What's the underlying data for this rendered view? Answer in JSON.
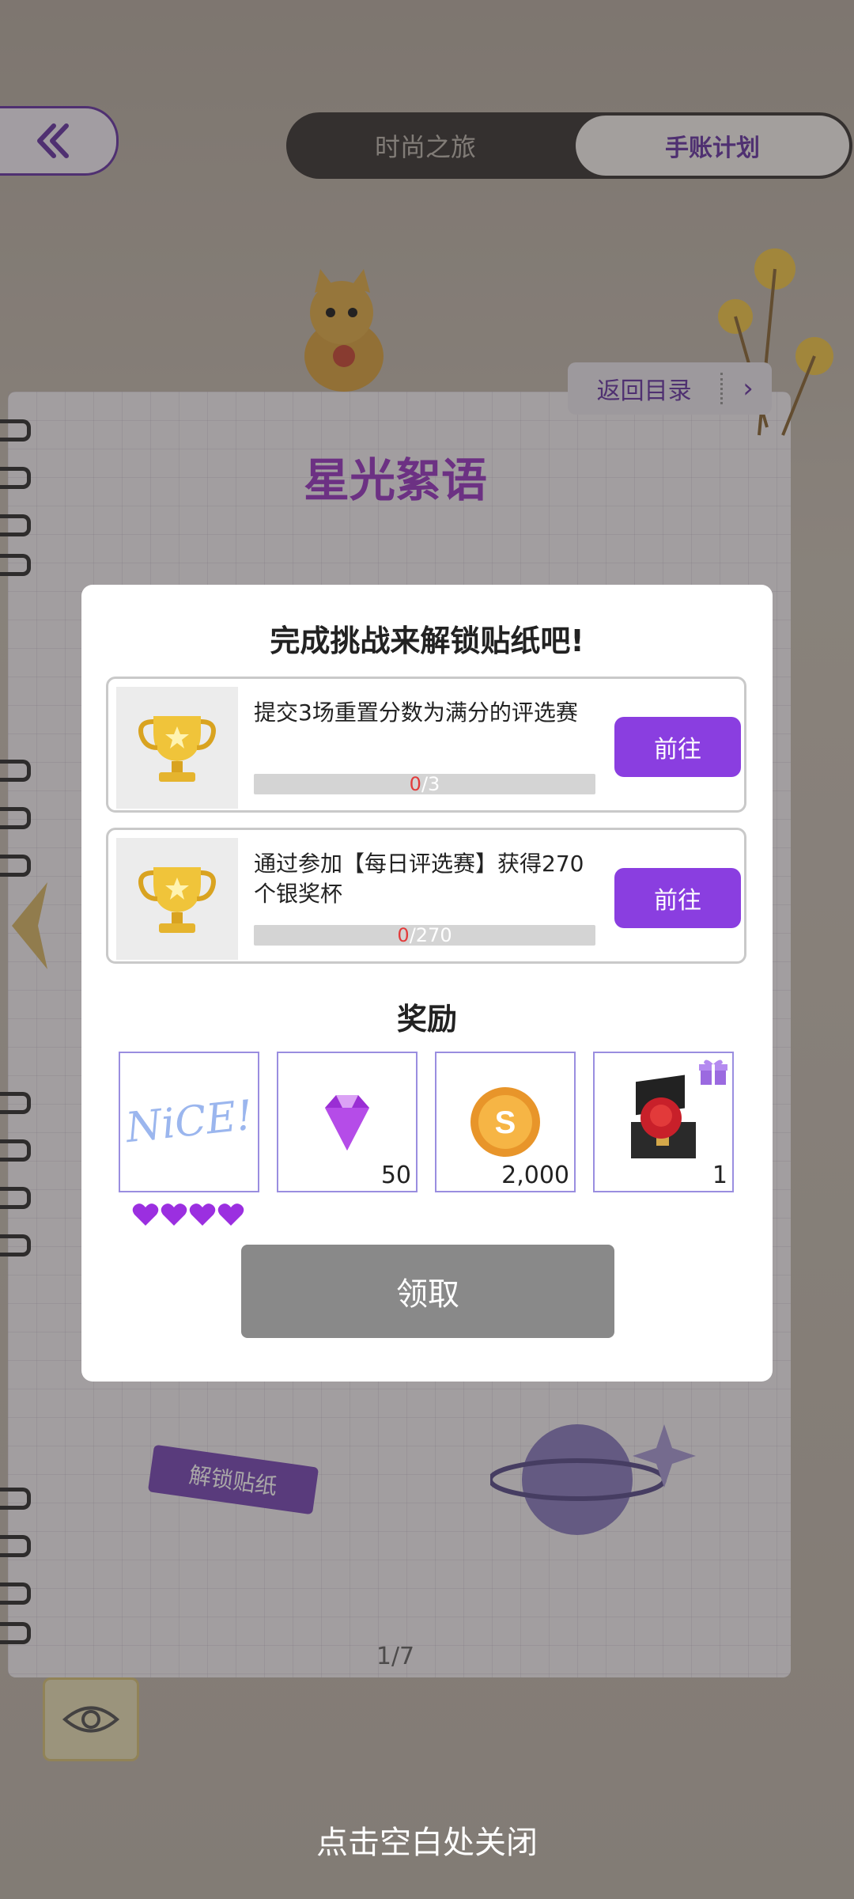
{
  "top_tabs": {
    "fashion": "时尚之旅",
    "journal": "手账计划"
  },
  "notebook": {
    "return_label": "返回目录",
    "title": "星光絮语",
    "unlock_tag": "解锁贴纸",
    "page_indicator": "1/7"
  },
  "modal": {
    "title": "完成挑战来解锁贴纸吧!",
    "tasks": [
      {
        "description": "提交3场重置分数为满分的评选赛",
        "progress_current": "0",
        "progress_total": "/3",
        "go_label": "前往"
      },
      {
        "description": "通过参加【每日评选赛】获得270个银奖杯",
        "progress_current": "0",
        "progress_total": "/270",
        "go_label": "前往"
      }
    ],
    "reward_title": "奖励",
    "rewards": [
      {
        "icon": "nice-sticker-icon",
        "art_text": "NiCE!",
        "quantity": ""
      },
      {
        "icon": "purple-gem-icon",
        "quantity": "50"
      },
      {
        "icon": "gold-coin-icon",
        "quantity": "2,000"
      },
      {
        "icon": "rose-chest-icon",
        "quantity": "1"
      }
    ],
    "sticker_hearts": 4,
    "claim_label": "领取"
  },
  "close_hint": "点击空白处关闭",
  "colors": {
    "accent_purple": "#8a3ee0",
    "progress_current": "#e23b3b",
    "claim_disabled": "#898989"
  }
}
